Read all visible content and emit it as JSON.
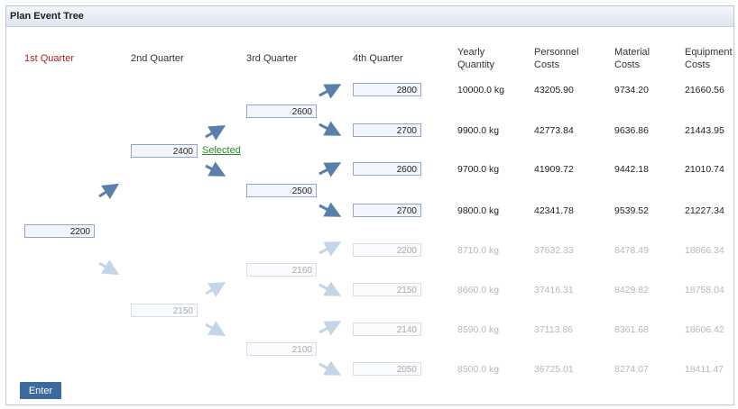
{
  "window": {
    "title": "Plan Event Tree"
  },
  "headers": {
    "q1": "1st Quarter",
    "q2": "2nd Quarter",
    "q3": "3rd Quarter",
    "q4": "4th Quarter",
    "yearly_1": "Yearly",
    "yearly_2": "Quantity",
    "personnel_1": "Personnel",
    "personnel_2": "Costs",
    "material_1": "Material",
    "material_2": "Costs",
    "equipment_1": "Equipment",
    "equipment_2": "Costs"
  },
  "tree": {
    "q1": {
      "value": "2200"
    },
    "q2": [
      {
        "value": "2400",
        "active": true
      },
      {
        "value": "2150",
        "active": false
      }
    ],
    "q3": [
      {
        "value": "2600"
      },
      {
        "value": "2500"
      },
      {
        "value": "2160"
      },
      {
        "value": "2100"
      }
    ],
    "selected_label": "Selected"
  },
  "rows": [
    {
      "q4": "2800",
      "yearly": "10000.0 kg",
      "personnel": "43205.90",
      "material": "9734.20",
      "equipment": "21660.56",
      "active": true
    },
    {
      "q4": "2700",
      "yearly": "9900.0 kg",
      "personnel": "42773.84",
      "material": "9636.86",
      "equipment": "21443.95",
      "active": true
    },
    {
      "q4": "2600",
      "yearly": "9700.0 kg",
      "personnel": "41909.72",
      "material": "9442.18",
      "equipment": "21010.74",
      "active": true
    },
    {
      "q4": "2700",
      "yearly": "9800.0 kg",
      "personnel": "42341.78",
      "material": "9539.52",
      "equipment": "21227.34",
      "active": true
    },
    {
      "q4": "2200",
      "yearly": "8710.0 kg",
      "personnel": "37632.33",
      "material": "8478.49",
      "equipment": "18866.34",
      "active": false
    },
    {
      "q4": "2150",
      "yearly": "8660.0 kg",
      "personnel": "37416.31",
      "material": "8429.82",
      "equipment": "18758.04",
      "active": false
    },
    {
      "q4": "2140",
      "yearly": "8590.0 kg",
      "personnel": "37113.86",
      "material": "8361.68",
      "equipment": "18606.42",
      "active": false
    },
    {
      "q4": "2050",
      "yearly": "8500.0 kg",
      "personnel": "36725.01",
      "material": "8274.07",
      "equipment": "18411.47",
      "active": false
    }
  ],
  "buttons": {
    "enter": "Enter"
  },
  "colors": {
    "arrow_active": "#5a7fab",
    "arrow_dim": "#c5d4e6"
  }
}
